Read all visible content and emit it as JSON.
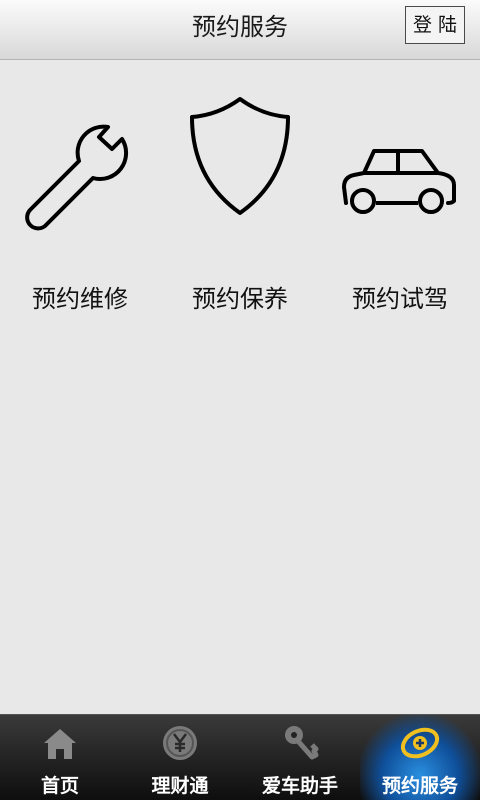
{
  "header": {
    "title": "预约服务",
    "login_label": "登陆"
  },
  "services": [
    {
      "label": "预约维修",
      "icon": "wrench-icon"
    },
    {
      "label": "预约保养",
      "icon": "shield-icon"
    },
    {
      "label": "预约试驾",
      "icon": "car-icon"
    }
  ],
  "tabbar": {
    "tabs": [
      {
        "label": "首页",
        "icon": "home-icon",
        "active": false
      },
      {
        "label": "理财通",
        "icon": "yen-coin-icon",
        "active": false
      },
      {
        "label": "爱车助手",
        "icon": "keys-icon",
        "active": false
      },
      {
        "label": "预约服务",
        "icon": "appointment-icon",
        "active": true
      }
    ]
  },
  "colors": {
    "background": "#e8e8e8",
    "tabbar": "#1a1a1a",
    "active_tab_glow": "#2a8fe0",
    "active_icon": "#f0c020"
  }
}
